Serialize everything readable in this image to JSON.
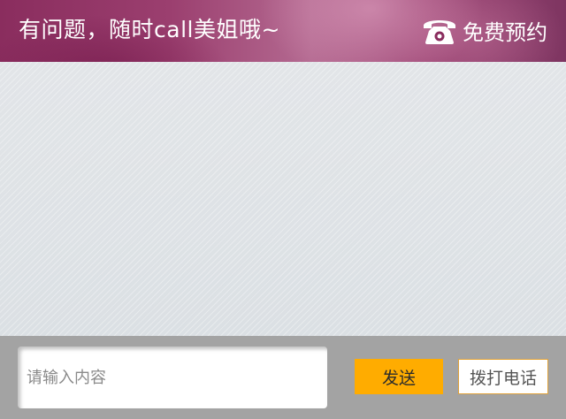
{
  "header": {
    "title": "有问题，随时call美姐哦~",
    "booking": {
      "icon": "phone-icon",
      "label": "免费预约"
    }
  },
  "chat": {
    "messages": []
  },
  "composer": {
    "input_value": "",
    "input_placeholder": "请输入内容",
    "send_label": "发送",
    "call_label": "拨打电话"
  },
  "colors": {
    "header_accent": "#9b3f6f",
    "send_button": "#ffac00",
    "call_button_border": "#e0a23a",
    "bottom_bar": "#a3a3a3",
    "chat_background": "#dfe3e7"
  }
}
